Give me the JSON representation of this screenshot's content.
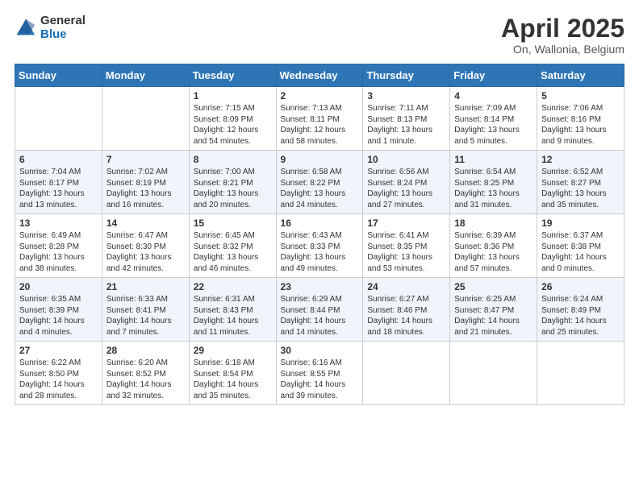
{
  "header": {
    "logo_general": "General",
    "logo_blue": "Blue",
    "title": "April 2025",
    "subtitle": "On, Wallonia, Belgium"
  },
  "calendar": {
    "days_of_week": [
      "Sunday",
      "Monday",
      "Tuesday",
      "Wednesday",
      "Thursday",
      "Friday",
      "Saturday"
    ],
    "weeks": [
      [
        {
          "day": "",
          "info": ""
        },
        {
          "day": "",
          "info": ""
        },
        {
          "day": "1",
          "info": "Sunrise: 7:15 AM\nSunset: 8:09 PM\nDaylight: 12 hours\nand 54 minutes."
        },
        {
          "day": "2",
          "info": "Sunrise: 7:13 AM\nSunset: 8:11 PM\nDaylight: 12 hours\nand 58 minutes."
        },
        {
          "day": "3",
          "info": "Sunrise: 7:11 AM\nSunset: 8:13 PM\nDaylight: 13 hours\nand 1 minute."
        },
        {
          "day": "4",
          "info": "Sunrise: 7:09 AM\nSunset: 8:14 PM\nDaylight: 13 hours\nand 5 minutes."
        },
        {
          "day": "5",
          "info": "Sunrise: 7:06 AM\nSunset: 8:16 PM\nDaylight: 13 hours\nand 9 minutes."
        }
      ],
      [
        {
          "day": "6",
          "info": "Sunrise: 7:04 AM\nSunset: 8:17 PM\nDaylight: 13 hours\nand 13 minutes."
        },
        {
          "day": "7",
          "info": "Sunrise: 7:02 AM\nSunset: 8:19 PM\nDaylight: 13 hours\nand 16 minutes."
        },
        {
          "day": "8",
          "info": "Sunrise: 7:00 AM\nSunset: 8:21 PM\nDaylight: 13 hours\nand 20 minutes."
        },
        {
          "day": "9",
          "info": "Sunrise: 6:58 AM\nSunset: 8:22 PM\nDaylight: 13 hours\nand 24 minutes."
        },
        {
          "day": "10",
          "info": "Sunrise: 6:56 AM\nSunset: 8:24 PM\nDaylight: 13 hours\nand 27 minutes."
        },
        {
          "day": "11",
          "info": "Sunrise: 6:54 AM\nSunset: 8:25 PM\nDaylight: 13 hours\nand 31 minutes."
        },
        {
          "day": "12",
          "info": "Sunrise: 6:52 AM\nSunset: 8:27 PM\nDaylight: 13 hours\nand 35 minutes."
        }
      ],
      [
        {
          "day": "13",
          "info": "Sunrise: 6:49 AM\nSunset: 8:28 PM\nDaylight: 13 hours\nand 38 minutes."
        },
        {
          "day": "14",
          "info": "Sunrise: 6:47 AM\nSunset: 8:30 PM\nDaylight: 13 hours\nand 42 minutes."
        },
        {
          "day": "15",
          "info": "Sunrise: 6:45 AM\nSunset: 8:32 PM\nDaylight: 13 hours\nand 46 minutes."
        },
        {
          "day": "16",
          "info": "Sunrise: 6:43 AM\nSunset: 8:33 PM\nDaylight: 13 hours\nand 49 minutes."
        },
        {
          "day": "17",
          "info": "Sunrise: 6:41 AM\nSunset: 8:35 PM\nDaylight: 13 hours\nand 53 minutes."
        },
        {
          "day": "18",
          "info": "Sunrise: 6:39 AM\nSunset: 8:36 PM\nDaylight: 13 hours\nand 57 minutes."
        },
        {
          "day": "19",
          "info": "Sunrise: 6:37 AM\nSunset: 8:38 PM\nDaylight: 14 hours\nand 0 minutes."
        }
      ],
      [
        {
          "day": "20",
          "info": "Sunrise: 6:35 AM\nSunset: 8:39 PM\nDaylight: 14 hours\nand 4 minutes."
        },
        {
          "day": "21",
          "info": "Sunrise: 6:33 AM\nSunset: 8:41 PM\nDaylight: 14 hours\nand 7 minutes."
        },
        {
          "day": "22",
          "info": "Sunrise: 6:31 AM\nSunset: 8:43 PM\nDaylight: 14 hours\nand 11 minutes."
        },
        {
          "day": "23",
          "info": "Sunrise: 6:29 AM\nSunset: 8:44 PM\nDaylight: 14 hours\nand 14 minutes."
        },
        {
          "day": "24",
          "info": "Sunrise: 6:27 AM\nSunset: 8:46 PM\nDaylight: 14 hours\nand 18 minutes."
        },
        {
          "day": "25",
          "info": "Sunrise: 6:25 AM\nSunset: 8:47 PM\nDaylight: 14 hours\nand 21 minutes."
        },
        {
          "day": "26",
          "info": "Sunrise: 6:24 AM\nSunset: 8:49 PM\nDaylight: 14 hours\nand 25 minutes."
        }
      ],
      [
        {
          "day": "27",
          "info": "Sunrise: 6:22 AM\nSunset: 8:50 PM\nDaylight: 14 hours\nand 28 minutes."
        },
        {
          "day": "28",
          "info": "Sunrise: 6:20 AM\nSunset: 8:52 PM\nDaylight: 14 hours\nand 32 minutes."
        },
        {
          "day": "29",
          "info": "Sunrise: 6:18 AM\nSunset: 8:54 PM\nDaylight: 14 hours\nand 35 minutes."
        },
        {
          "day": "30",
          "info": "Sunrise: 6:16 AM\nSunset: 8:55 PM\nDaylight: 14 hours\nand 39 minutes."
        },
        {
          "day": "",
          "info": ""
        },
        {
          "day": "",
          "info": ""
        },
        {
          "day": "",
          "info": ""
        }
      ]
    ]
  }
}
